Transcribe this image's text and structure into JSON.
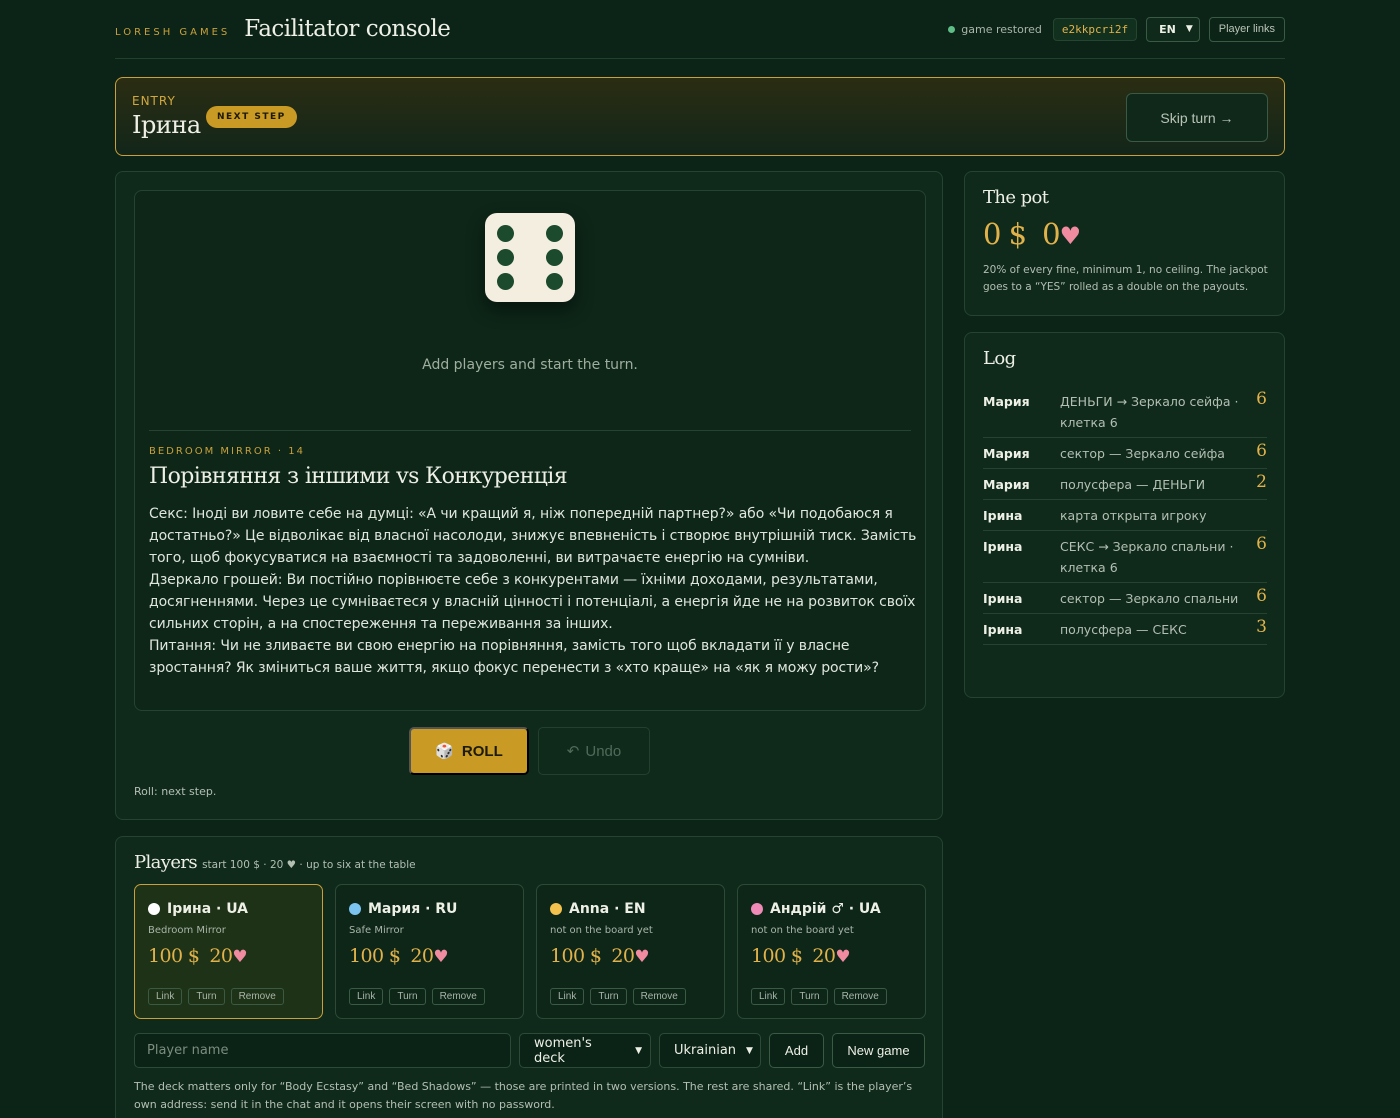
{
  "header": {
    "brand": "LORESH GAMES",
    "title": "Facilitator console",
    "status": "game restored",
    "game_code": "e2kkpcri2f",
    "language": "EN",
    "player_links": "Player links"
  },
  "entry": {
    "label": "ENTRY",
    "name": "Ірина",
    "badge": "NEXT STEP",
    "skip": "Skip turn →"
  },
  "board": {
    "die_value": 6,
    "hint": "Add players and start the turn.",
    "kicker": "BEDROOM MIRROR · 14",
    "title": "Порівняння з іншими vs Конкуренція",
    "body": [
      "Секс: Іноді ви ловите себе на думці: «А чи кращий я, ніж попередній партнер?» або «Чи подобаюся я достатньо?» Це відволікає від власної насолоди, знижує впевненість і створює внутрішній тиск. Замість того, щоб фокусуватися на взаємності та задоволенні, ви витрачаєте енергію на сумніви.",
      "Дзеркало грошей: Ви постійно порівнюєте себе з конкурентами — їхніми доходами, результатами, досягненнями. Через це сумніваєтеся у власній цінності і потенціалі, а енергія йде не на розвиток своїх сильних сторін, а на спостереження та переживання за інших.",
      "Питання: Чи не зливаєте ви свою енергію на порівняння, замість того щоб вкладати її у власне зростання? Як зміниться ваше життя, якщо фокус перенести з «хто краще» на «як я можу рости»?"
    ],
    "roll": "ROLL",
    "undo": "Undo",
    "roll_note": "Roll: next step."
  },
  "pot": {
    "title": "The pot",
    "money": "0 $",
    "hearts": "0",
    "note": "20% of every fine, minimum 1, no ceiling. The jackpot goes to a “YES” rolled as a double on the payouts."
  },
  "log": {
    "title": "Log",
    "rows": [
      {
        "who": "Мария",
        "what": "ДЕНЬГИ → Зеркало сейфа · клетка 6",
        "num": "6"
      },
      {
        "who": "Мария",
        "what": "сектор — Зеркало сейфа",
        "num": "6"
      },
      {
        "who": "Мария",
        "what": "полусфера — ДЕНЬГИ",
        "num": "2"
      },
      {
        "who": "Ірина",
        "what": "карта открыта игроку",
        "num": ""
      },
      {
        "who": "Ірина",
        "what": "СЕКС → Зеркало спальни · клетка 6",
        "num": "6"
      },
      {
        "who": "Ірина",
        "what": "сектор — Зеркало спальни",
        "num": "6"
      },
      {
        "who": "Ірина",
        "what": "полусфера — СЕКС",
        "num": "3"
      }
    ]
  },
  "players": {
    "title": "Players",
    "subtitle": "start 100 $ · 20 ♥ · up to six at the table",
    "list": [
      {
        "name": "Ірина · UA",
        "sub": "Bedroom Mirror",
        "money": "100 $",
        "hearts": "20",
        "color": "#ffffff"
      },
      {
        "name": "Мария · RU",
        "sub": "Safe Mirror",
        "money": "100 $",
        "hearts": "20",
        "color": "#7cc4f0"
      },
      {
        "name": "Anna · EN",
        "sub": "not on the board yet",
        "money": "100 $",
        "hearts": "20",
        "color": "#f2c14e"
      },
      {
        "name": "Андрій ♂ · UA",
        "sub": "not on the board yet",
        "money": "100 $",
        "hearts": "20",
        "color": "#f08bb8"
      }
    ],
    "actions": {
      "link": "Link",
      "turn": "Turn",
      "remove": "Remove"
    },
    "name_placeholder": "Player name",
    "deck": "women's deck",
    "language": "Ukrainian",
    "add": "Add",
    "new_game": "New game",
    "note": "The deck matters only for “Body Ecstasy” and “Bed Shadows” — those are printed in two versions. The rest are shared. “Link” is the player’s own address: send it in the chat and it opens their screen with no password."
  },
  "colors": {
    "accent": "#c99a24",
    "background": "#0c2417",
    "heart": "#f08ba0",
    "status_ok": "#5fbd86"
  }
}
